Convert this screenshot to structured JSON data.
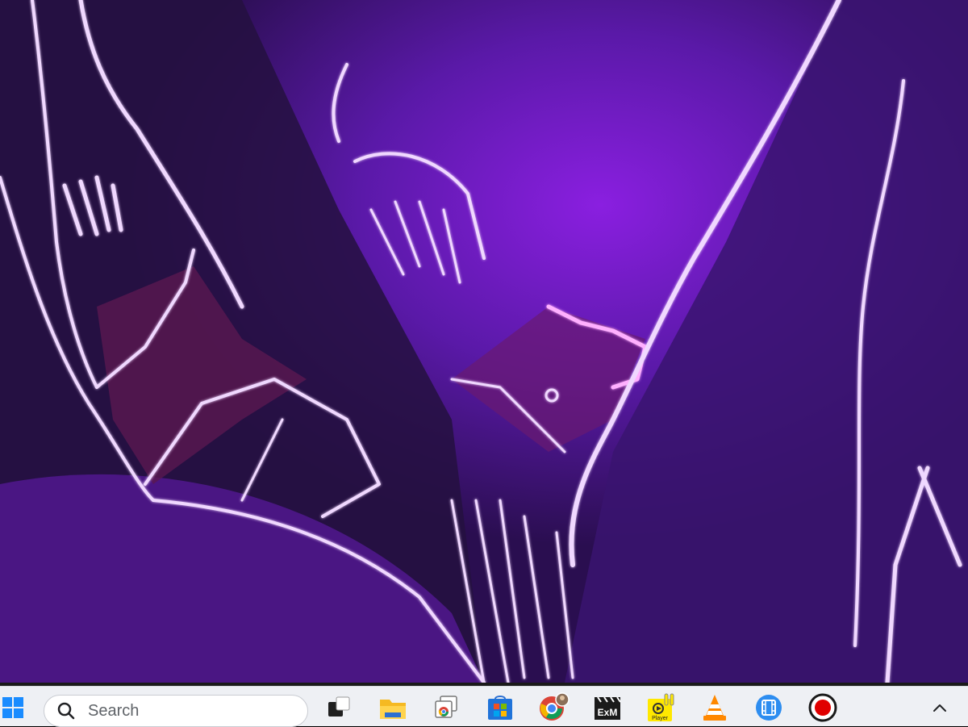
{
  "video": {
    "description_icon": "video-frame"
  },
  "taskbar": {
    "start_icon": "windows-start-icon",
    "search": {
      "placeholder": "Search",
      "icon": "search-icon"
    },
    "apps": [
      {
        "name": "task-view-icon"
      },
      {
        "name": "file-explorer-icon"
      },
      {
        "name": "chrome-app-icon"
      },
      {
        "name": "microsoft-store-icon"
      },
      {
        "name": "chrome-profile-icon"
      },
      {
        "name": "exm-icon"
      },
      {
        "name": "player-icon",
        "label": "Player"
      },
      {
        "name": "vlc-icon"
      },
      {
        "name": "media-player-icon"
      },
      {
        "name": "record-icon"
      }
    ],
    "tray": {
      "chevron_icon": "chevron-up-icon"
    },
    "exm_label": "ExM",
    "player_label": "Player"
  },
  "colors": {
    "video_bg": "#2a0f4e",
    "accent_purple": "#7a1fc4",
    "taskbar_bg": "#eef0f4"
  }
}
